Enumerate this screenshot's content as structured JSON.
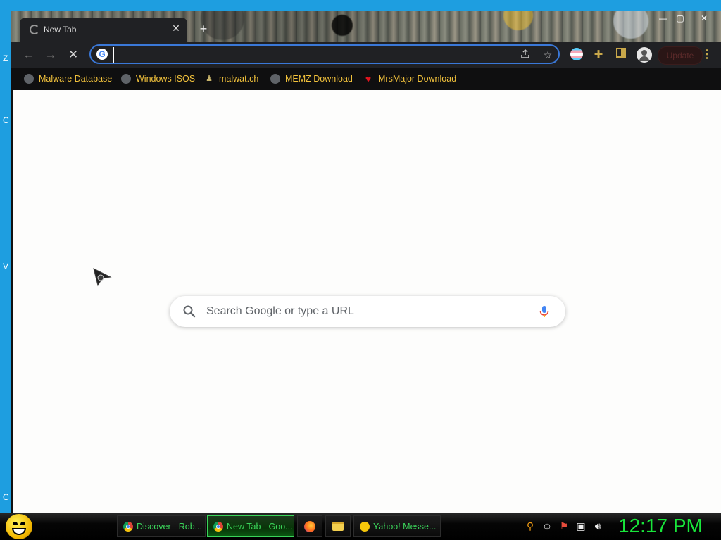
{
  "browser": {
    "tab": {
      "title": "New Tab",
      "close": "✕"
    },
    "new_tab": "+",
    "window_controls": {
      "minimize": "—",
      "maximize": "▢",
      "close": "✕"
    },
    "nav": {
      "back": "←",
      "forward": "→",
      "stop": "✕"
    },
    "omnibox": {
      "value": "",
      "logo": "G"
    },
    "update_label": "Update",
    "bookmarks": [
      {
        "label": "Malware Database",
        "icon": "globe-icon"
      },
      {
        "label": "Windows ISOS",
        "icon": "globe-icon"
      },
      {
        "label": "malwat.ch",
        "icon": "malwatch-icon"
      },
      {
        "label": "MEMZ Download",
        "icon": "globe-icon"
      },
      {
        "label": "MrsMajor Download",
        "icon": "heart-icon"
      }
    ]
  },
  "newtab": {
    "search_placeholder": "Search Google or type a URL"
  },
  "taskbar": {
    "tasks": [
      {
        "label": "Discover - Rob...",
        "icon": "chrome-icon",
        "active": false
      },
      {
        "label": "New Tab - Goo...",
        "icon": "chrome-icon",
        "active": true
      },
      {
        "label": "",
        "icon": "firefox-icon",
        "active": false
      },
      {
        "label": "",
        "icon": "folder-icon",
        "active": false
      },
      {
        "label": "Yahoo! Messe...",
        "icon": "yahoo-messenger-icon",
        "active": false
      }
    ],
    "clock": "12:17 PM"
  },
  "colors": {
    "desktop": "#1e9ee0",
    "bookmark_text": "#f2c23c",
    "taskbar_text": "#3bd45a",
    "clock": "#18e63a",
    "omnibox_border": "#3a78d8"
  }
}
